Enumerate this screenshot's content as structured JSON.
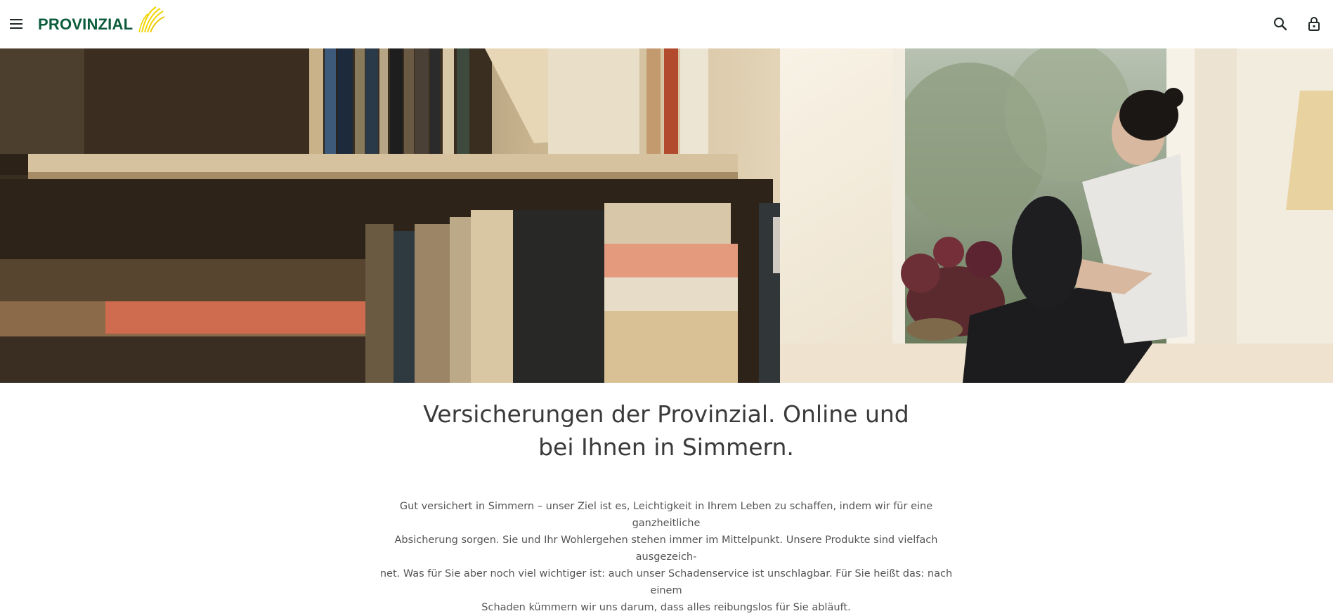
{
  "header": {
    "logo_text": "PROVINZIAL",
    "icons": [
      "menu-icon",
      "search-icon",
      "lock-icon"
    ]
  },
  "hero": {
    "image_description_icon": "hero-photo"
  },
  "main": {
    "headline_line1": "Versicherungen der Provinzial. Online und",
    "headline_line2": "bei Ihnen in Simmern.",
    "body_line1": "Gut versichert in Simmern – unser Ziel ist es, Leichtigkeit in Ihrem Leben zu schaffen, indem wir für eine ganzheitliche",
    "body_line2": "Absicherung sorgen. Sie und Ihr Wohlergehen stehen immer im Mittelpunkt. Unsere Produkte sind vielfach ausgezeich-",
    "body_line3": "net. Was für Sie aber noch viel wichtiger ist: auch unser Schadenservice ist unschlagbar. Für Sie heißt das: nach einem",
    "body_line4": "Schaden kümmern wir uns darum, dass alles reibungslos für Sie abläuft."
  },
  "colors": {
    "brand_green": "#0b5c3b",
    "brand_yellow": "#f2d400",
    "text_dark": "#3a3a3a"
  }
}
